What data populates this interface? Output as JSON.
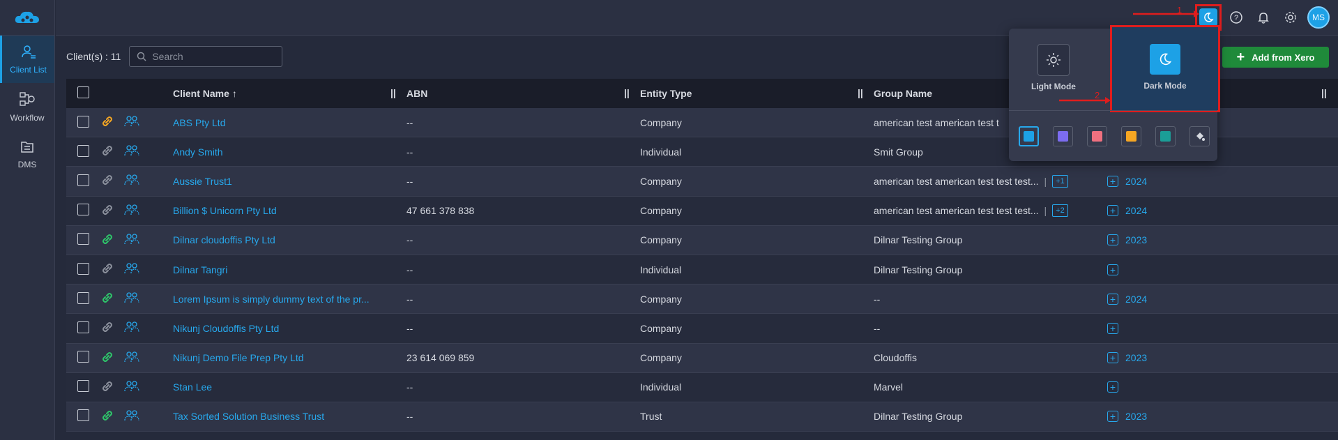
{
  "sidebar": {
    "items": [
      {
        "label": "Client List",
        "icon": "user-list-icon",
        "active": true
      },
      {
        "label": "Workflow",
        "icon": "workflow-icon",
        "active": false
      },
      {
        "label": "DMS",
        "icon": "folder-icon",
        "active": false
      }
    ]
  },
  "topbar": {
    "avatar_initials": "MS",
    "icons": [
      "moon-icon",
      "help-icon",
      "bell-icon",
      "gear-icon"
    ]
  },
  "toolbar": {
    "count_label": "Client(s) : 11",
    "search_placeholder": "Search",
    "add_button_label": "Add from Xero"
  },
  "table": {
    "columns": [
      "Client Name",
      "ABN",
      "Entity Type",
      "Group Name"
    ],
    "rows": [
      {
        "name": "ABS Pty Ltd",
        "abn": "--",
        "type": "Company",
        "group": "american test american test t",
        "badge": "",
        "year": "",
        "show_plus": false,
        "link_color": "#f5a623"
      },
      {
        "name": "Andy Smith",
        "abn": "--",
        "type": "Individual",
        "group": "Smit Group",
        "badge": "",
        "year": "",
        "show_plus": false,
        "link_color": "#8b909c"
      },
      {
        "name": "Aussie Trust1",
        "abn": "--",
        "type": "Company",
        "group": "american test american test test test...",
        "badge": "+1",
        "year": "2024",
        "show_plus": true,
        "link_color": "#8b909c"
      },
      {
        "name": "Billion $ Unicorn Pty Ltd",
        "abn": "47 661 378 838",
        "type": "Company",
        "group": "american test american test test test...",
        "badge": "+2",
        "year": "2024",
        "show_plus": true,
        "link_color": "#8b909c"
      },
      {
        "name": "Dilnar cloudoffis Pty Ltd",
        "abn": "--",
        "type": "Company",
        "group": "Dilnar Testing Group",
        "badge": "",
        "year": "2023",
        "show_plus": true,
        "link_color": "#2ec46a"
      },
      {
        "name": "Dilnar Tangri",
        "abn": "--",
        "type": "Individual",
        "group": "Dilnar Testing Group",
        "badge": "",
        "year": "",
        "show_plus": true,
        "link_color": "#8b909c"
      },
      {
        "name": "Lorem Ipsum is simply dummy text of the pr...",
        "abn": "--",
        "type": "Company",
        "group": "--",
        "badge": "",
        "year": "2024",
        "show_plus": true,
        "link_color": "#2ec46a"
      },
      {
        "name": "Nikunj Cloudoffis Pty Ltd",
        "abn": "--",
        "type": "Company",
        "group": "--",
        "badge": "",
        "year": "",
        "show_plus": true,
        "link_color": "#8b909c"
      },
      {
        "name": "Nikunj Demo File Prep Pty Ltd",
        "abn": "23 614 069 859",
        "type": "Company",
        "group": "Cloudoffis",
        "badge": "",
        "year": "2023",
        "show_plus": true,
        "link_color": "#2ec46a"
      },
      {
        "name": "Stan Lee",
        "abn": "--",
        "type": "Individual",
        "group": "Marvel",
        "badge": "",
        "year": "",
        "show_plus": true,
        "link_color": "#8b909c"
      },
      {
        "name": "Tax Sorted Solution Business Trust",
        "abn": "--",
        "type": "Trust",
        "group": "Dilnar Testing Group",
        "badge": "",
        "year": "2023",
        "show_plus": true,
        "link_color": "#2ec46a"
      }
    ]
  },
  "theme_popup": {
    "light_label": "Light Mode",
    "dark_label": "Dark Mode",
    "swatches": [
      "#1da1e6",
      "#7c6cf0",
      "#f0707f",
      "#f5a623",
      "#1b9e97",
      "custom"
    ]
  },
  "annotations": {
    "step1": "1",
    "step2": "2"
  },
  "colors": {
    "accent": "#1da1e6",
    "highlight": "#e01d1d",
    "xero_green": "#1f8a3a"
  }
}
